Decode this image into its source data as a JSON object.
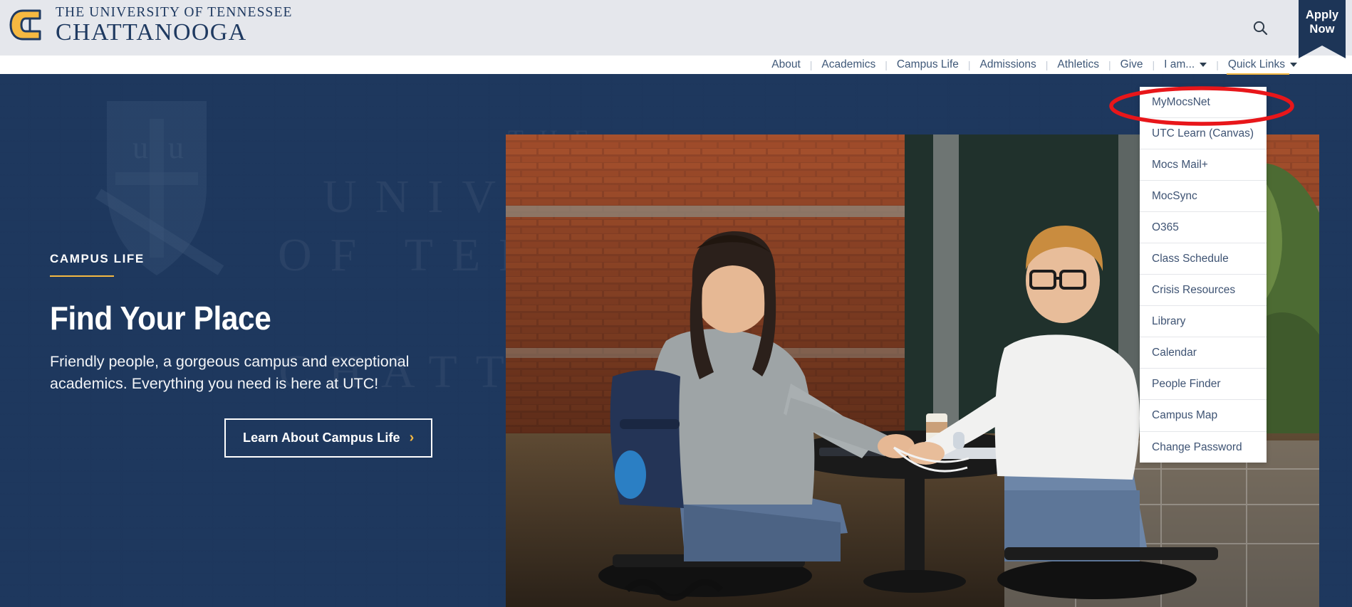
{
  "header": {
    "logo": {
      "mark_icon": "utc-power-c-icon",
      "line1": "THE UNIVERSITY OF TENNESSEE",
      "line2": "CHATTANOOGA"
    },
    "search_icon": "search-icon",
    "apply": {
      "line1": "Apply",
      "line2": "Now"
    },
    "background_color": "#e5e7ec"
  },
  "nav": {
    "items": [
      {
        "label": "About",
        "has_caret": false,
        "active": false
      },
      {
        "label": "Academics",
        "has_caret": false,
        "active": false
      },
      {
        "label": "Campus Life",
        "has_caret": false,
        "active": false
      },
      {
        "label": "Admissions",
        "has_caret": false,
        "active": false
      },
      {
        "label": "Athletics",
        "has_caret": false,
        "active": false
      },
      {
        "label": "Give",
        "has_caret": false,
        "active": false
      },
      {
        "label": "I am...",
        "has_caret": true,
        "active": false
      },
      {
        "label": "Quick Links",
        "has_caret": true,
        "active": true
      }
    ],
    "separator": "|",
    "active_underline_color": "#f5b841"
  },
  "dropdown": {
    "parent": "Quick Links",
    "items": [
      "MyMocsNet",
      "UTC Learn (Canvas)",
      "Mocs Mail+",
      "MocSync",
      "O365",
      "Class Schedule",
      "Crisis Resources",
      "Library",
      "Calendar",
      "People Finder",
      "Campus Map",
      "Change Password"
    ]
  },
  "annotation": {
    "shape": "ellipse",
    "color": "#e8161a",
    "targets": "MyMocsNet"
  },
  "hero": {
    "eyebrow_strong": "CAMPUS",
    "eyebrow_light": " LIFE",
    "title": "Find Your Place",
    "subtitle": "Friendly people, a gorgeous campus and exceptional academics. Everything you need is here at UTC!",
    "button_label": "Learn About Campus Life",
    "button_chevron": "›",
    "watermark_lines": [
      "THE",
      "UNIVERSITY",
      "OF TENNESSEE",
      "AT",
      "CHATTANOOGA"
    ],
    "background_color": "#1f3a61",
    "accent_color": "#f5b841"
  }
}
